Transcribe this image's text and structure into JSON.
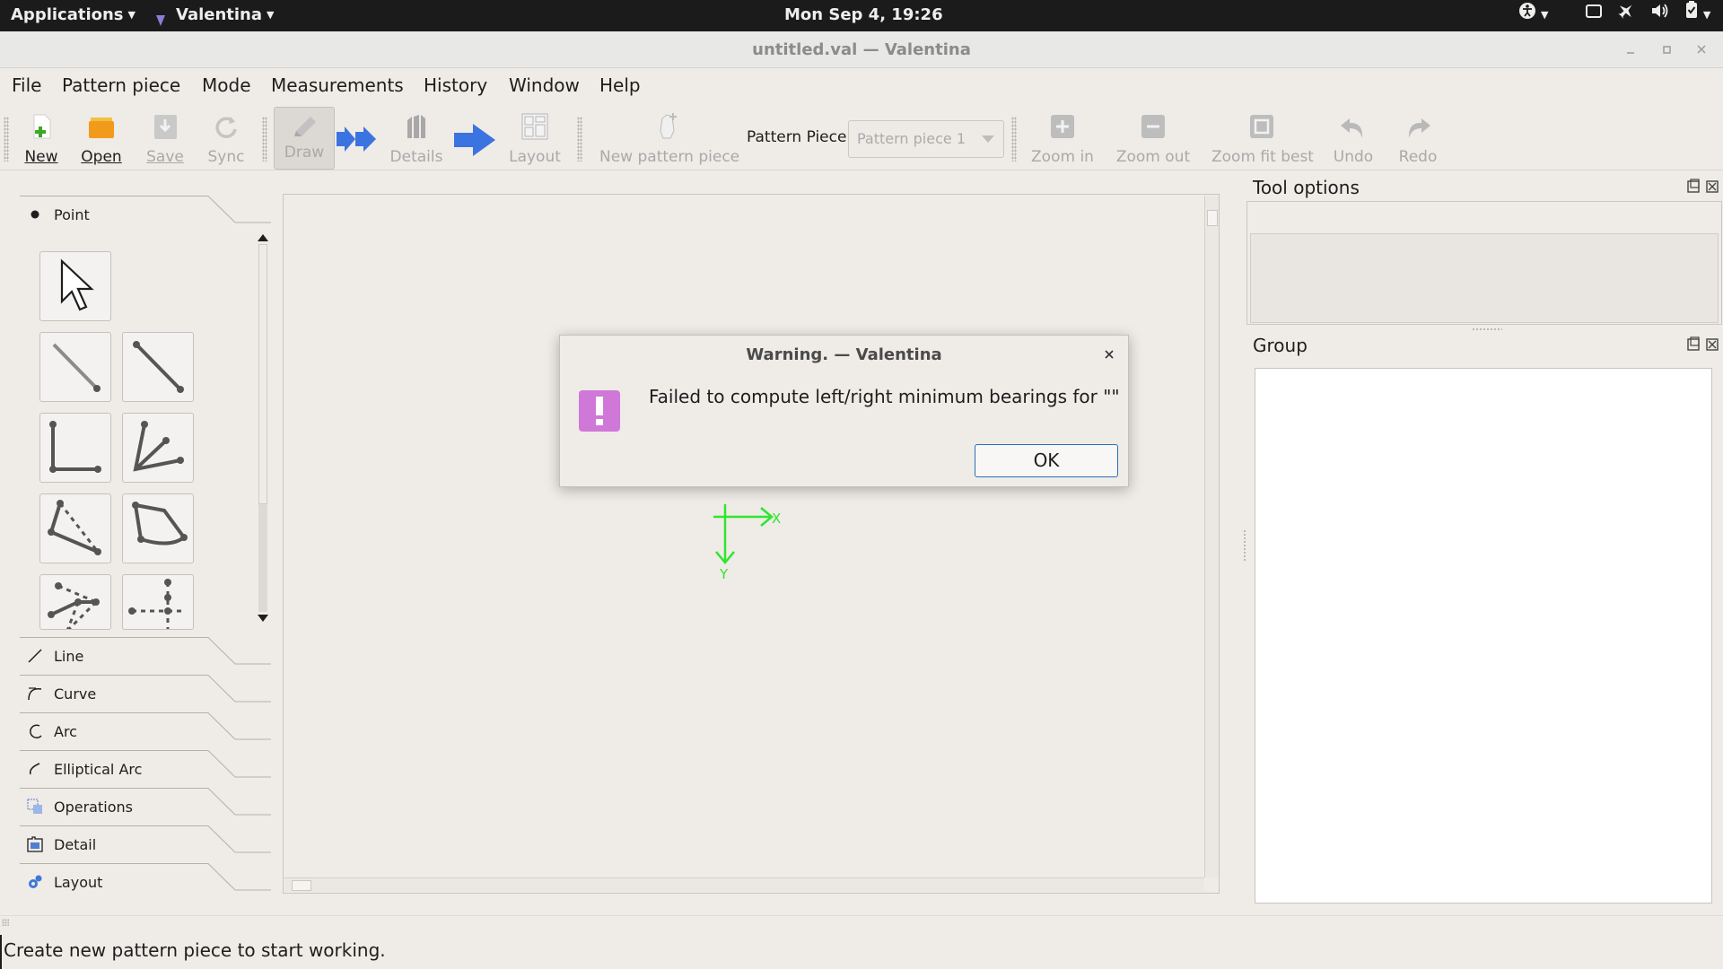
{
  "topbar": {
    "applications": "Applications",
    "app_name": "Valentina",
    "clock": "Mon Sep  4, 19:26"
  },
  "window": {
    "title": "untitled.val — Valentina"
  },
  "menubar": {
    "items": [
      "File",
      "Pattern piece",
      "Mode",
      "Measurements",
      "History",
      "Window",
      "Help"
    ]
  },
  "toolbar": {
    "new": "New",
    "open": "Open",
    "save": "Save",
    "sync": "Sync",
    "draw": "Draw",
    "details": "Details",
    "layout": "Layout",
    "new_pattern_piece": "New pattern piece",
    "pattern_piece_label": "Pattern Piece:",
    "pattern_piece_value": "Pattern piece 1",
    "zoom_in": "Zoom in",
    "zoom_out": "Zoom out",
    "zoom_fit_best": "Zoom fit best",
    "undo": "Undo",
    "redo": "Redo"
  },
  "toolbox": {
    "categories": [
      "Point",
      "Line",
      "Curve",
      "Arc",
      "Elliptical Arc",
      "Operations",
      "Detail",
      "Layout"
    ]
  },
  "canvas": {
    "axis_x": "X",
    "axis_y": "Y"
  },
  "docks": {
    "tool_options": "Tool options",
    "group": "Group"
  },
  "dialog": {
    "title": "Warning. — Valentina",
    "message": "Failed to compute left/right minimum bearings for \"\"",
    "ok": "OK",
    "icon": "warning-exclamation-icon"
  },
  "statusbar": {
    "text": "Create new pattern piece to start working."
  },
  "colors": {
    "axis_green": "#2ee62e",
    "dialog_icon": "#cf78d8",
    "ok_border": "#2a6fb6",
    "arrow_blue": "#3b73e0"
  }
}
